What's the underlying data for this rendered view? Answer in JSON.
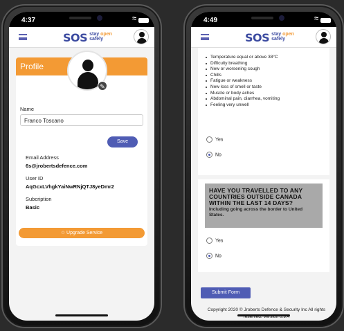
{
  "left_phone": {
    "status": {
      "time": "4:37"
    },
    "logo": {
      "brand": "SOS",
      "tag_line1": "stay",
      "tag_line1b": "open",
      "tag_line2": "safely"
    },
    "profile": {
      "title": "Profile",
      "name_label": "Name",
      "name_value": "Franco Toscano",
      "save_label": "Save",
      "email_label": "Email Address",
      "email_value": "6s@jrobertsdefence.com",
      "userid_label": "User ID",
      "userid_value": "AqGcxLVhgkYaiNwRNjQTJ8yeDmr2",
      "subscription_label": "Subcription",
      "subscription_value": "Basic",
      "upgrade_label": "☆ Upgrade Service"
    }
  },
  "right_phone": {
    "status": {
      "time": "4:49"
    },
    "logo": {
      "brand": "SOS",
      "tag_line1": "stay",
      "tag_line1b": "open",
      "tag_line2": "safely"
    },
    "symptoms": [
      "Temperature equal or above 38°C",
      "Difficulty breathing",
      "New or worsening cough",
      "Chills",
      "Fatigue or weakness",
      "New loss of smell or taste",
      "Muscle or body aches",
      "Abdominal pain, diarrhea, vomiting",
      "Feeling very unwell"
    ],
    "q1_yes": "Yes",
    "q1_no": "No",
    "travel_question": "HAVE YOU TRAVELLED TO ANY COUNTRIES OUTSIDE CANADA WITHIN THE LAST 14 DAYS?",
    "travel_sub": "Including going across the border to United States.",
    "q2_yes": "Yes",
    "q2_no": "No",
    "submit_label": "Submit Form",
    "copyright": "Copyright 2020 © Jroberts Defence & Security Inc All rights reserved. Version 0.9.4"
  },
  "colors": {
    "accent_orange": "#f39a34",
    "accent_blue": "#4f5cb4"
  }
}
